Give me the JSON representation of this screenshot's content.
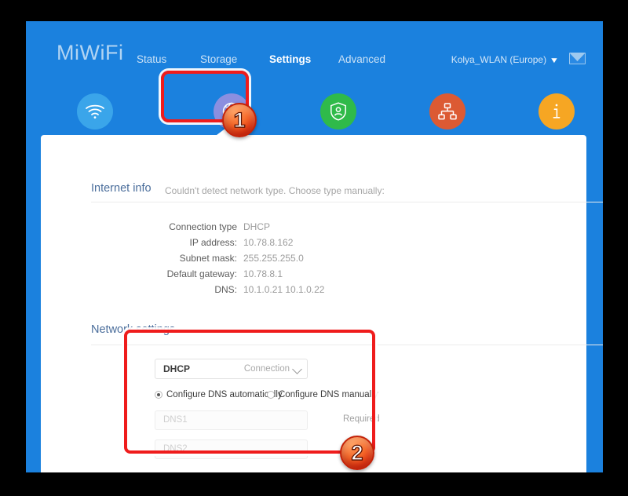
{
  "browser": {
    "brand": "MiWiFi"
  },
  "nav": {
    "items": [
      {
        "label": "Status",
        "active": false
      },
      {
        "label": "Storage",
        "active": false
      },
      {
        "label": "Settings",
        "active": true
      },
      {
        "label": "Advanced",
        "active": false
      }
    ],
    "account": "Kolya_WLAN (Europe)",
    "account_chevron": "chevron-down-icon",
    "mail_icon": "mail-icon"
  },
  "icon_tabs": [
    {
      "label": "Wi-Fi settings",
      "icon": "wifi-icon",
      "color": "#3aa5ea",
      "selected": false
    },
    {
      "label": "Network settings",
      "icon": "globe-icon",
      "color": "#8b8fe0",
      "selected": true
    },
    {
      "label": "Security",
      "icon": "shield-person-icon",
      "color": "#2fba4a",
      "selected": false
    },
    {
      "label": "LAN settings",
      "icon": "network-nodes-icon",
      "color": "#dc5a33",
      "selected": false
    },
    {
      "label": "Status",
      "icon": "info-icon",
      "color": "#f6a623",
      "selected": false
    }
  ],
  "internet_info": {
    "title": "Internet info",
    "detect_message": "Couldn't detect network type. Choose type manually:",
    "rows": [
      {
        "label": "Connection type",
        "value": "DHCP"
      },
      {
        "label": "IP address:",
        "value": "10.78.8.162"
      },
      {
        "label": "Subnet mask:",
        "value": "255.255.255.0"
      },
      {
        "label": "Default gateway:",
        "value": "10.78.8.1"
      },
      {
        "label": "DNS:",
        "value": "10.1.0.21 10.1.0.22"
      }
    ]
  },
  "network_settings": {
    "title": "Network settings",
    "connection_select": {
      "value": "DHCP",
      "side_label": "Connection",
      "chevron": "chevron-down-icon"
    },
    "dns_mode": {
      "auto_label": "Configure DNS automatically",
      "manual_label": "Configure DNS manually",
      "selected": "auto"
    },
    "dns1": {
      "placeholder": "DNS1",
      "value": "",
      "hint": "Required"
    },
    "dns2": {
      "placeholder": "DNS2",
      "value": ""
    }
  },
  "annotations": {
    "highlight_color": "#ef1c1c",
    "badges": [
      {
        "number": "1"
      },
      {
        "number": "2"
      }
    ]
  }
}
